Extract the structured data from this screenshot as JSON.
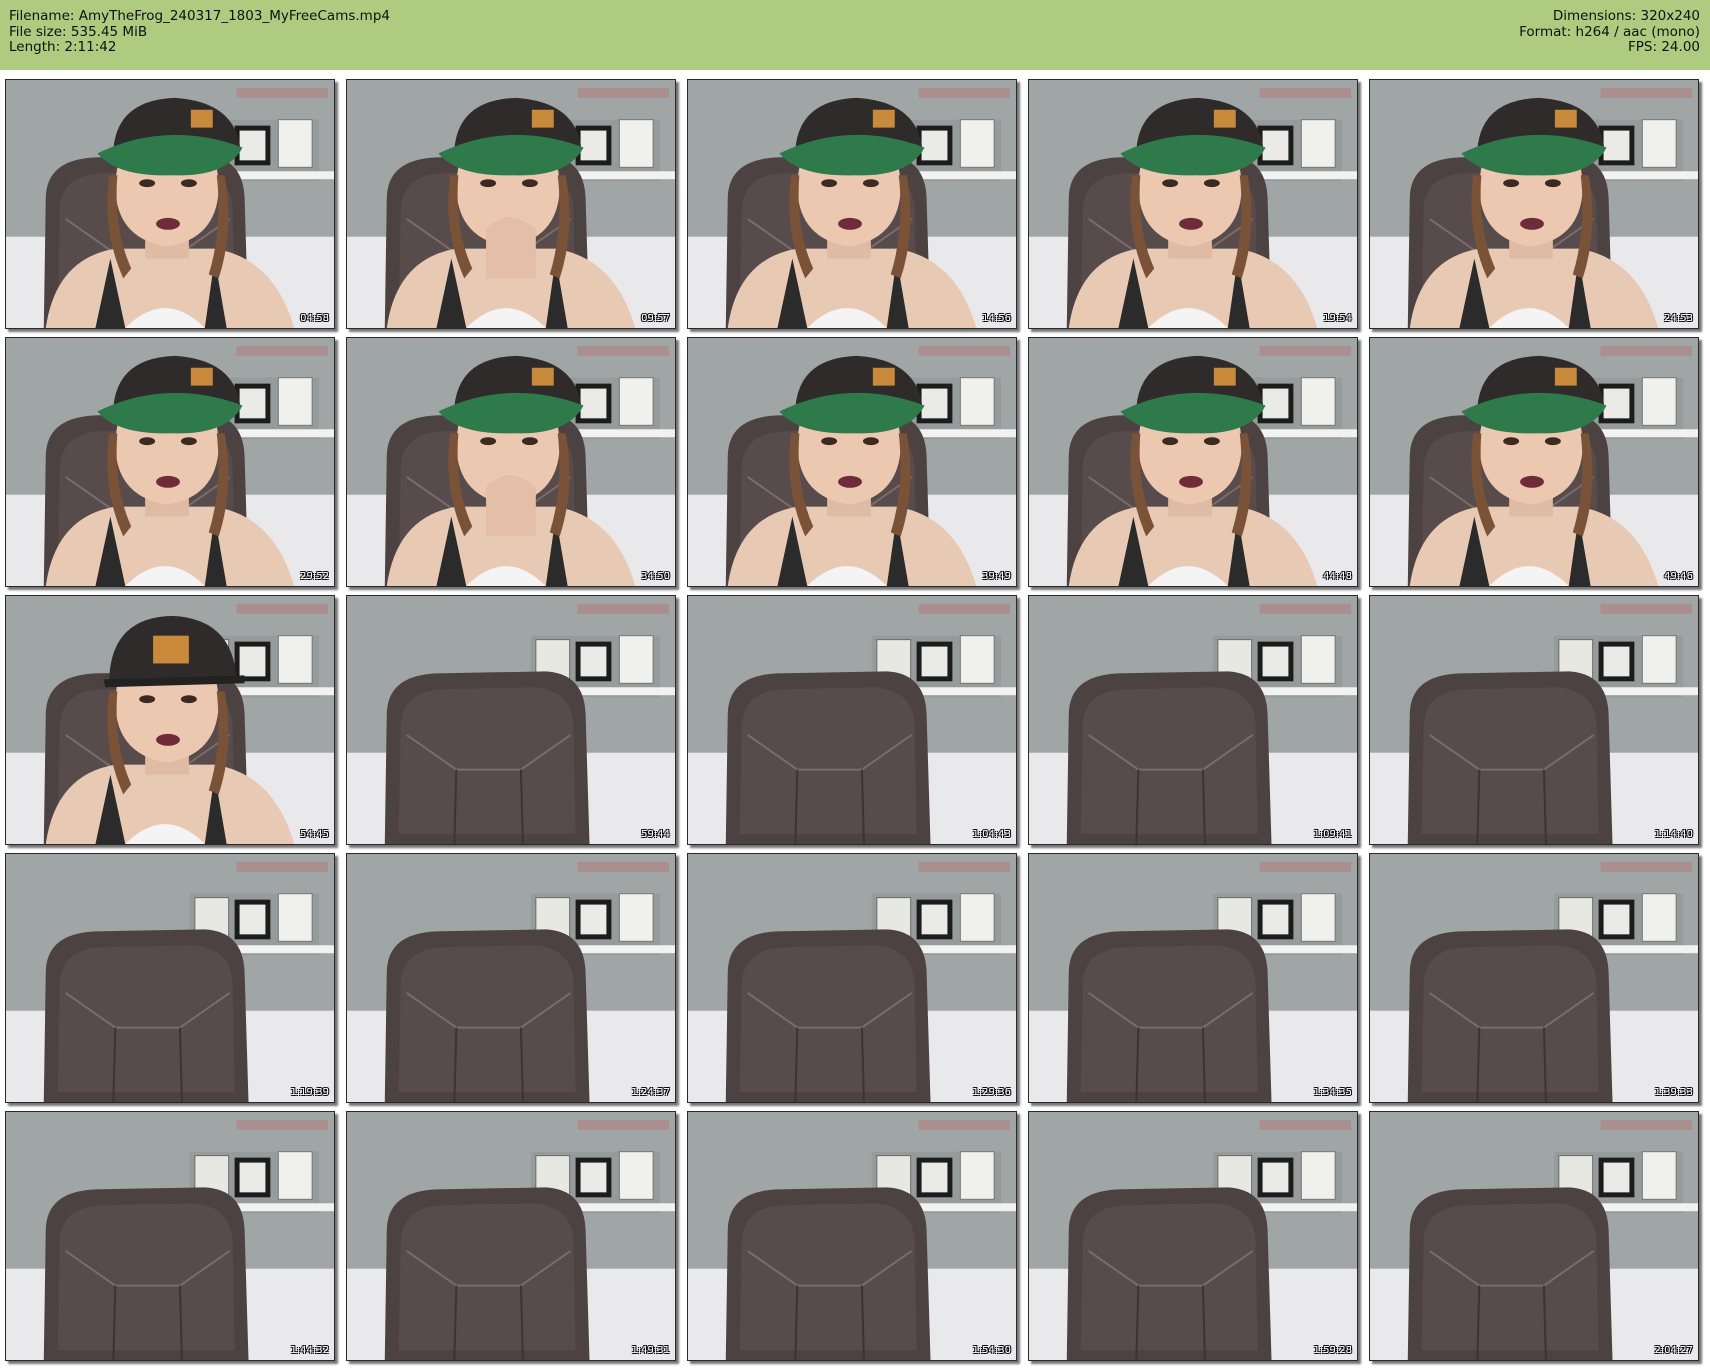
{
  "header": {
    "filename": "Filename: AmyTheFrog_240317_1803_MyFreeCams.mp4",
    "filesize": "File size: 535.45 MiB",
    "length": "Length: 2:11:42",
    "dimensions": "Dimensions: 320x240",
    "format": "Format: h264 / aac (mono)",
    "fps": "FPS: 24.00"
  },
  "colors": {
    "header_bg": "#aecb80",
    "wall": "#9aa0a2",
    "chair": "#4d4242",
    "cap": "#2f2b2b",
    "cap_brim": "#2f7a4a"
  },
  "thumbnails": [
    {
      "time": "04:58",
      "scene": "person-cap-side"
    },
    {
      "time": "09:57",
      "scene": "person-cap-hand"
    },
    {
      "time": "14:56",
      "scene": "person-cap"
    },
    {
      "time": "19:54",
      "scene": "person-close"
    },
    {
      "time": "24:53",
      "scene": "person-close"
    },
    {
      "time": "29:52",
      "scene": "person-cap"
    },
    {
      "time": "34:50",
      "scene": "person-cap-hand"
    },
    {
      "time": "39:49",
      "scene": "person-cap"
    },
    {
      "time": "44:48",
      "scene": "person-close"
    },
    {
      "time": "49:46",
      "scene": "person-close"
    },
    {
      "time": "54:45",
      "scene": "person-cap-back"
    },
    {
      "time": "59:44",
      "scene": "empty-chair"
    },
    {
      "time": "1:04:43",
      "scene": "empty-chair"
    },
    {
      "time": "1:09:41",
      "scene": "empty-chair"
    },
    {
      "time": "1:14:40",
      "scene": "empty-chair"
    },
    {
      "time": "1:19:39",
      "scene": "empty-chair"
    },
    {
      "time": "1:24:37",
      "scene": "empty-chair"
    },
    {
      "time": "1:29:36",
      "scene": "empty-chair"
    },
    {
      "time": "1:34:35",
      "scene": "empty-chair"
    },
    {
      "time": "1:39:33",
      "scene": "empty-chair"
    },
    {
      "time": "1:44:32",
      "scene": "empty-chair"
    },
    {
      "time": "1:49:31",
      "scene": "empty-chair"
    },
    {
      "time": "1:54:30",
      "scene": "empty-chair"
    },
    {
      "time": "1:59:28",
      "scene": "empty-chair"
    },
    {
      "time": "2:04:27",
      "scene": "empty-chair"
    }
  ]
}
